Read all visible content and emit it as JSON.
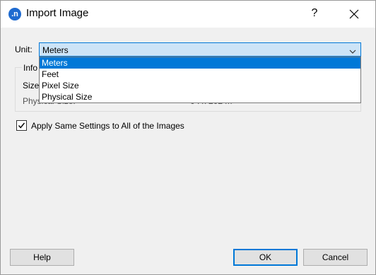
{
  "window": {
    "title": "Import Image",
    "app_icon_glyph": ".n",
    "help_glyph": "?"
  },
  "unit": {
    "label": "Unit:",
    "selected": "Meters",
    "options": [
      "Meters",
      "Feet",
      "Pixel Size",
      "Physical Size"
    ]
  },
  "info": {
    "group_title": "Info",
    "row1_label": "Size",
    "row2_label": "Physical Size:",
    "row2_value": "0 . x 202 m"
  },
  "apply_all": {
    "label": "Apply Same Settings to All of the Images",
    "checked": true
  },
  "buttons": {
    "help": "Help",
    "ok": "OK",
    "cancel": "Cancel"
  },
  "colors": {
    "accent": "#0078d7",
    "selected_field": "#cce4f7",
    "app_icon": "#1f6bd0"
  }
}
